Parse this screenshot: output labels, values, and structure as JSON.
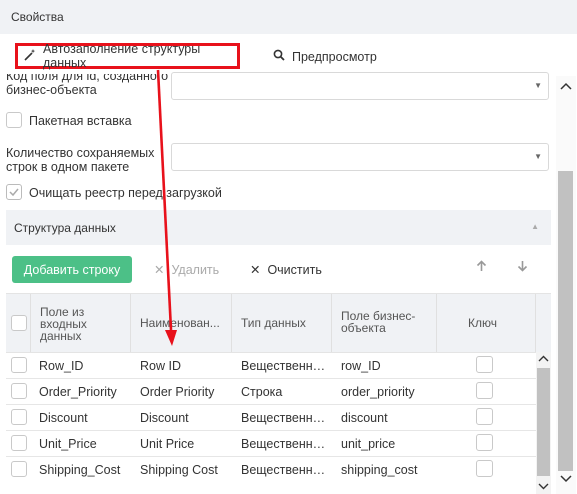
{
  "header": {
    "title": "Свойства"
  },
  "toolbar": {
    "autofill_label": "Автозаполнение структуры данных",
    "preview_label": "Предпросмотр"
  },
  "fields": {
    "key_field_label_line1": "Код поля для id, созданного",
    "key_field_label_line2": "бизнес-объекта",
    "batch_insert_label": "Пакетная вставка",
    "rows_per_batch_label_line1": "Количество сохраняемых",
    "rows_per_batch_label_line2": "строк в одном пакете",
    "clear_registry_label": "Очищать реестр перед загрузкой"
  },
  "section": {
    "title": "Структура данных"
  },
  "grid_toolbar": {
    "add_label": "Добавить строку",
    "delete_label": "Удалить",
    "clear_label": "Очистить"
  },
  "grid": {
    "columns": [
      {
        "l1": "Поле из",
        "l2": "входных",
        "l3": "данных"
      },
      {
        "l1": "Наименован...",
        "l2": "",
        "l3": ""
      },
      {
        "l1": "Тип данных",
        "l2": "",
        "l3": ""
      },
      {
        "l1": "Поле бизнес-",
        "l2": "объекта",
        "l3": ""
      },
      {
        "l1": "Ключ",
        "l2": "",
        "l3": ""
      }
    ],
    "rows": [
      {
        "input": "Row_ID",
        "name": "Row ID",
        "type": "Вещественн…",
        "bo": "row_ID"
      },
      {
        "input": "Order_Priority",
        "name": "Order Priority",
        "type": "Строка",
        "bo": "order_priority"
      },
      {
        "input": "Discount",
        "name": "Discount",
        "type": "Вещественн…",
        "bo": "discount"
      },
      {
        "input": "Unit_Price",
        "name": "Unit Price",
        "type": "Вещественн…",
        "bo": "unit_price"
      },
      {
        "input": "Shipping_Cost",
        "name": "Shipping Cost",
        "type": "Вещественн…",
        "bo": "shipping_cost"
      }
    ]
  },
  "colors": {
    "accent_green": "#4cc087",
    "highlight_red": "#e8111b"
  }
}
